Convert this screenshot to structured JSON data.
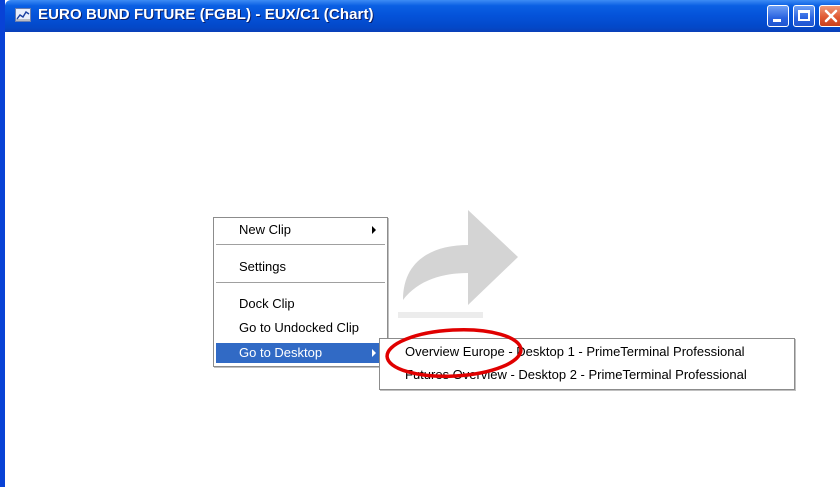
{
  "window": {
    "title": "EURO BUND FUTURE (FGBL) - EUX/C1 (Chart)",
    "icon": "chart-icon",
    "controls": [
      "minimize-icon",
      "maximize-icon",
      "close-icon"
    ]
  },
  "context_menu": {
    "items": [
      {
        "label": "New Clip",
        "has_submenu": true
      },
      {
        "label": "Settings",
        "has_submenu": false
      },
      {
        "label": "Dock Clip",
        "has_submenu": false
      },
      {
        "label": "Go to Undocked Clip",
        "has_submenu": false
      },
      {
        "label": "Go to Desktop",
        "has_submenu": true,
        "selected": true
      }
    ]
  },
  "submenu": {
    "items": [
      {
        "label": "Overview Europe - Desktop 1 - PrimeTerminal Professional"
      },
      {
        "label": "Futures Overview - Desktop 2 - PrimeTerminal Professional"
      }
    ]
  },
  "annotation": {
    "type": "red-ellipse",
    "target": "Overview Europe",
    "color": "#e00000"
  },
  "colors": {
    "titlebar": "#0452d9",
    "selection": "#316ac5",
    "close_button": "#e05a34"
  }
}
